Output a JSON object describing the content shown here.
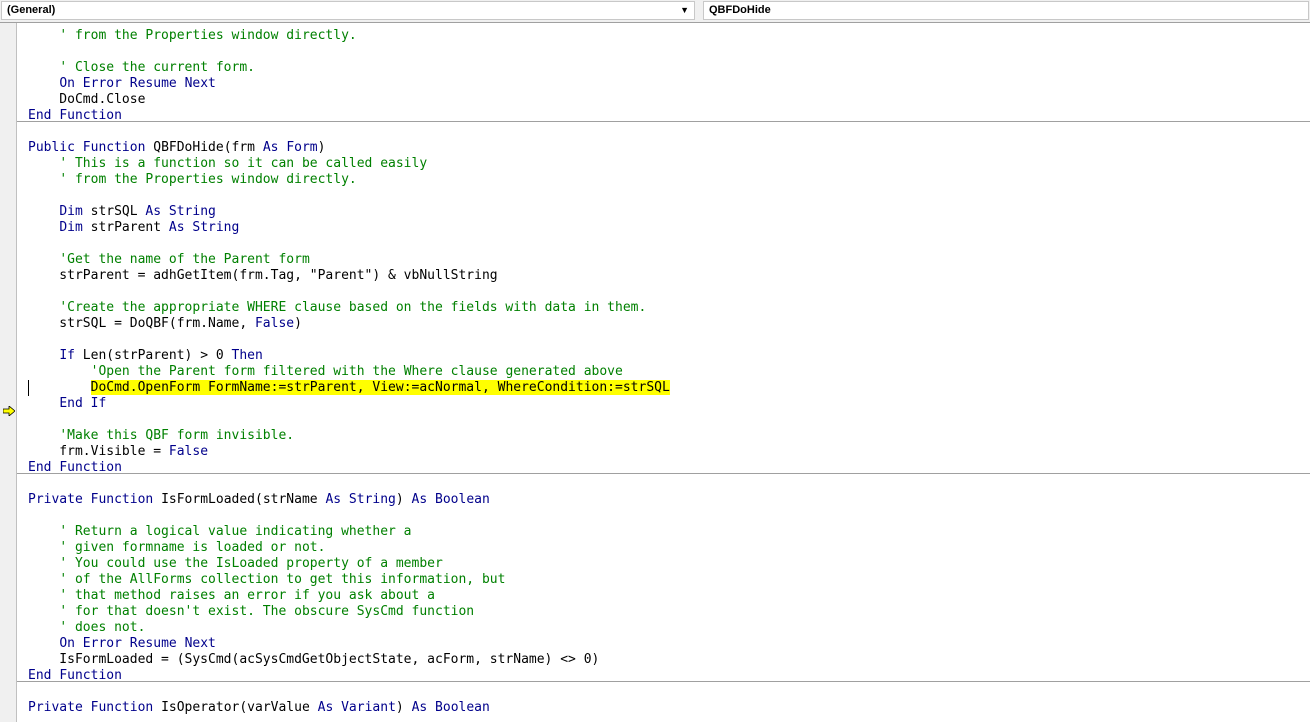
{
  "toolbar": {
    "object_combo": "(General)",
    "procedure_combo": "QBFDoHide"
  },
  "code_lines": [
    "    ' from the Properties window directly.",
    "",
    "    ' Close the current form.",
    "    On Error Resume Next",
    "    DoCmd.Close",
    "End Function",
    "",
    "Public Function QBFDoHide(frm As Form)",
    "    ' This is a function so it can be called easily",
    "    ' from the Properties window directly.",
    "",
    "    Dim strSQL As String",
    "    Dim strParent As String",
    "",
    "    'Get the name of the Parent form",
    "    strParent = adhGetItem(frm.Tag, \"Parent\") & vbNullString",
    "",
    "    'Create the appropriate WHERE clause based on the fields with data in them.",
    "    strSQL = DoQBF(frm.Name, False)",
    "",
    "    If Len(strParent) > 0 Then",
    "        'Open the Parent form filtered with the Where clause generated above",
    "        DoCmd.OpenForm FormName:=strParent, View:=acNormal, WhereCondition:=strSQL",
    "    End If",
    "",
    "    'Make this QBF form invisible.",
    "    frm.Visible = False",
    "End Function",
    "",
    "Private Function IsFormLoaded(strName As String) As Boolean",
    "",
    "    ' Return a logical value indicating whether a",
    "    ' given formname is loaded or not.",
    "    ' You could use the IsLoaded property of a member",
    "    ' of the AllForms collection to get this information, but",
    "    ' that method raises an error if you ask about a",
    "    ' for that doesn't exist. The obscure SysCmd function",
    "    ' does not.",
    "    On Error Resume Next",
    "    IsFormLoaded = (SysCmd(acSysCmdGetObjectState, acForm, strName) <> 0)",
    "End Function",
    "",
    "Private Function IsOperator(varValue As Variant) As Boolean"
  ],
  "highlighted_line_index": 22,
  "colors": {
    "keyword": "#00008b",
    "comment": "#008000",
    "highlight": "#ffff00",
    "execution_arrow": "#ffff00"
  },
  "icons": {
    "execution_pointer": "execution-arrow-icon"
  }
}
